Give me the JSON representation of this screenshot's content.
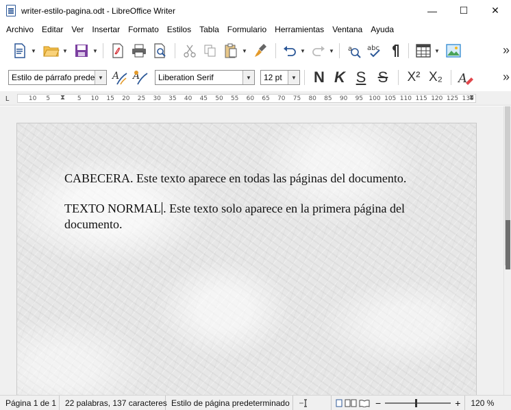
{
  "window": {
    "title": "writer-estilo-pagina.odt - LibreOffice Writer",
    "minimize": "—",
    "maximize": "☐",
    "close": "✕"
  },
  "menu": [
    {
      "label": "Archivo"
    },
    {
      "label": "Editar"
    },
    {
      "label": "Ver"
    },
    {
      "label": "Insertar"
    },
    {
      "label": "Formato"
    },
    {
      "label": "Estilos"
    },
    {
      "label": "Tabla"
    },
    {
      "label": "Formulario"
    },
    {
      "label": "Herramientas"
    },
    {
      "label": "Ventana"
    },
    {
      "label": "Ayuda"
    }
  ],
  "formatting": {
    "paragraph_style": "Estilo de párrafo predet",
    "font_name": "Liberation Serif",
    "font_size": "12 pt",
    "bold_label": "N",
    "italic_label": "K",
    "underline_label": "S",
    "strike_label": "S",
    "superscript_label": "X²",
    "subscript_label": "X₂",
    "more": "»"
  },
  "toolbar": {
    "more": "»"
  },
  "ruler": {
    "ticks": [
      "10",
      "5",
      "5",
      "10",
      "15",
      "20",
      "25",
      "30",
      "35",
      "40",
      "45",
      "50",
      "55",
      "60",
      "65",
      "70",
      "75",
      "80",
      "85",
      "90",
      "95",
      "100",
      "105",
      "110",
      "115",
      "120",
      "125",
      "130"
    ]
  },
  "document": {
    "header_text": "CABECERA. Este texto aparece en todas las páginas del documento.",
    "body_before_cursor": "TEXTO NORMAL",
    "body_after_cursor": ". Este texto solo aparece en la primera página del",
    "body_line2": "documento."
  },
  "status": {
    "page": "Página 1 de 1",
    "words": "22 palabras, 137 caracteres",
    "page_style": "Estilo de página predeterminado",
    "zoom_minus": "−",
    "zoom_plus": "+",
    "zoom": "120 %"
  },
  "colors": {
    "accent_blue": "#2b5797",
    "purple": "#7b3fa0",
    "orange": "#e39a2a"
  }
}
